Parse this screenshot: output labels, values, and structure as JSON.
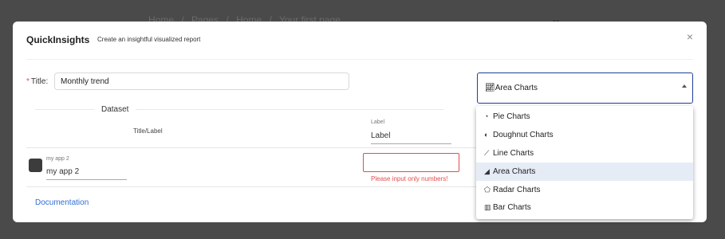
{
  "background": {
    "breadcrumb": [
      "Home",
      "/",
      "Pages",
      "/",
      "Home",
      "/",
      "Your first page"
    ],
    "icon": "expand-arrows-icon"
  },
  "modal": {
    "title": "QuickInsights",
    "subtitle": "Create an insightful visualized report",
    "close_icon": "×"
  },
  "form": {
    "title_label": "Title",
    "title_required_mark": "*",
    "title_colon": ":",
    "title_value": "Monthly trend"
  },
  "dataset": {
    "label": "Dataset",
    "column_title": "Title/Label",
    "label_caption": "Label",
    "label_value": "Label",
    "rows": [
      {
        "name_caption": "my app 2",
        "name_value": "my app 2",
        "number_value": "",
        "error": "Please input only numbers!"
      }
    ]
  },
  "footer": {
    "documentation_link": "Documentation"
  },
  "chart_type": {
    "selected_icon": "area-chart-icon",
    "selected_label": "Area Charts",
    "options": [
      {
        "label": "Pie Charts",
        "icon": "pie-chart-icon",
        "selected": false
      },
      {
        "label": "Doughnut Charts",
        "icon": "doughnut-chart-icon",
        "selected": false
      },
      {
        "label": "Line Charts",
        "icon": "line-chart-icon",
        "selected": false
      },
      {
        "label": "Area Charts",
        "icon": "area-chart-icon",
        "selected": true
      },
      {
        "label": "Radar Charts",
        "icon": "radar-chart-icon",
        "selected": false
      },
      {
        "label": "Bar Charts",
        "icon": "bar-chart-icon",
        "selected": false
      }
    ]
  },
  "colors": {
    "accent": "#1f3f99",
    "link": "#2f6fd6",
    "error": "#e34d4d",
    "selected_bg": "#e6ecf6",
    "swatch": "#3c3c3c"
  }
}
